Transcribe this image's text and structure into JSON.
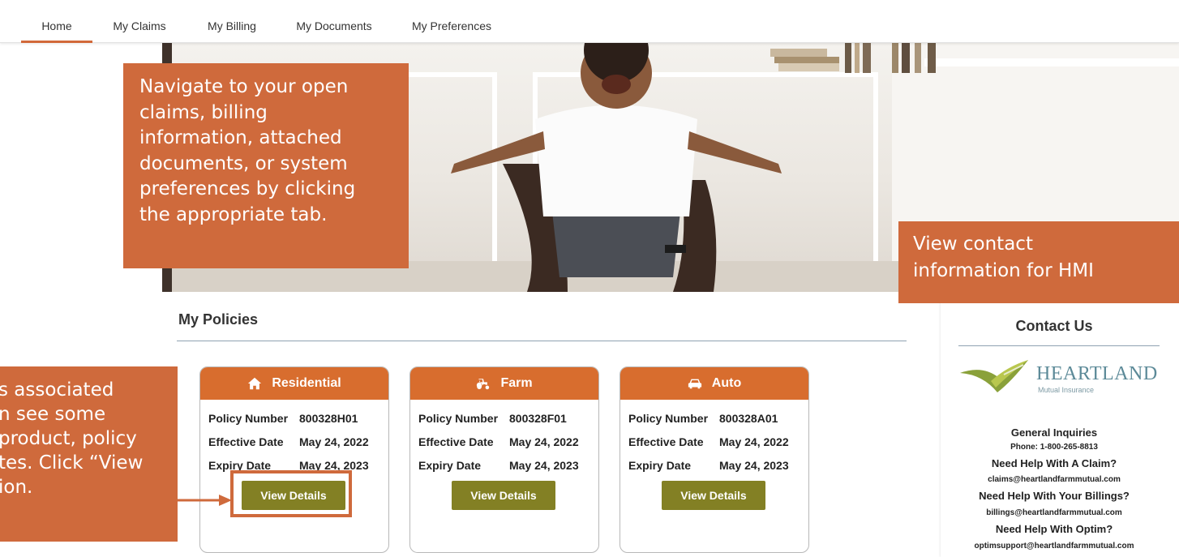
{
  "nav": {
    "tabs": [
      {
        "label": "Home",
        "active": true
      },
      {
        "label": "My Claims"
      },
      {
        "label": "My Billing"
      },
      {
        "label": "My Documents"
      },
      {
        "label": "My Preferences"
      }
    ]
  },
  "policies": {
    "title": "My Policies",
    "labels": {
      "policy_number": "Policy Number",
      "effective_date": "Effective Date",
      "expiry_date": "Expiry Date"
    },
    "view_label": "View Details",
    "cards": [
      {
        "type": "Residential",
        "icon": "home-icon",
        "policy_number": "800328H01",
        "effective_date": "May 24, 2022",
        "expiry_date": "May 24, 2023"
      },
      {
        "type": "Farm",
        "icon": "tractor-icon",
        "policy_number": "800328F01",
        "effective_date": "May 24, 2022",
        "expiry_date": "May 24, 2023"
      },
      {
        "type": "Auto",
        "icon": "car-icon",
        "policy_number": "800328A01",
        "effective_date": "May 24, 2022",
        "expiry_date": "May 24, 2023"
      }
    ]
  },
  "contact": {
    "title": "Contact Us",
    "logo": {
      "name": "HEARTLAND",
      "subtitle": "Mutual Insurance"
    },
    "general_heading": "General Inquiries",
    "phone": "Phone: 1-800-265-8813",
    "claim_heading": "Need Help With A Claim?",
    "claim_email": "claims@heartlandfarmmutual.com",
    "billing_heading": "Need Help With Your Billings?",
    "billing_email": "billings@heartlandfarmmutual.com",
    "optim_heading": "Need Help With Optim?",
    "optim_email": "optimsupport@heartlandfarmmutual.com"
  },
  "callouts": {
    "nav_lines": [
      "Navigate to your open",
      "claims, billing",
      "information, attached",
      "documents, or system",
      "preferences by clicking",
      "the appropriate tab."
    ],
    "contact_lines": [
      "View contact",
      "information for HMI"
    ],
    "policies_lines": [
      "s associated",
      "n see some",
      "product, policy",
      "tes. Click “View",
      "ion."
    ]
  },
  "colors": {
    "accent": "#d86d2e",
    "callout": "#cf6a3c",
    "button": "#838024"
  }
}
